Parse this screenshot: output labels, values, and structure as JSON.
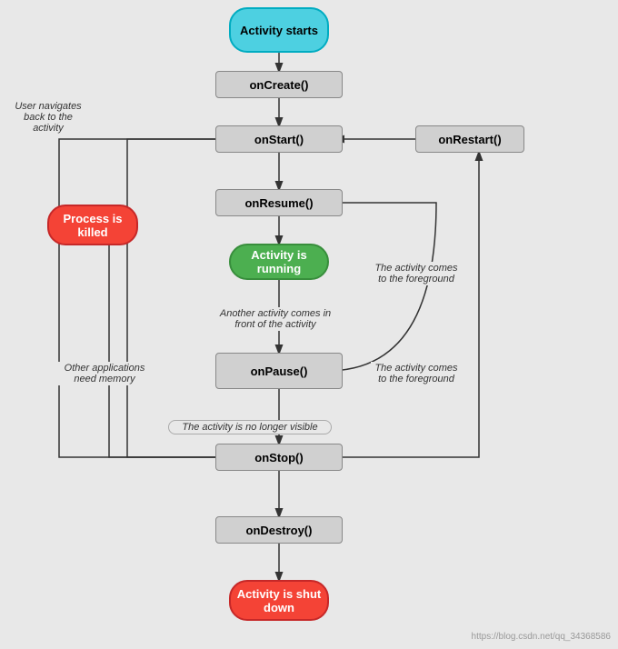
{
  "nodes": {
    "activity_starts": {
      "label": "Activity\nstarts",
      "type": "cyan"
    },
    "on_create": {
      "label": "onCreate()",
      "type": "rect"
    },
    "on_start": {
      "label": "onStart()",
      "type": "rect"
    },
    "on_restart": {
      "label": "onRestart()",
      "type": "rect"
    },
    "on_resume": {
      "label": "onResume()",
      "type": "rect"
    },
    "activity_running": {
      "label": "Activity is\nrunning",
      "type": "green"
    },
    "on_pause": {
      "label": "onPause()",
      "type": "rect"
    },
    "on_stop": {
      "label": "onStop()",
      "type": "rect"
    },
    "on_destroy": {
      "label": "onDestroy()",
      "type": "rect"
    },
    "activity_shutdown": {
      "label": "Activity is\nshut down",
      "type": "red"
    },
    "process_killed": {
      "label": "Process is\nkilled",
      "type": "red"
    }
  },
  "labels": {
    "user_navigates": "User navigates\nback to the\nactivity",
    "another_activity": "Another activity comes\nin front of the activity",
    "other_apps_memory": "Other applications\nneed memory",
    "activity_foreground1": "The activity\ncomes to the\nforeground",
    "activity_foreground2": "The activity\ncomes to the\nforeground",
    "no_longer_visible": "The activity is no longer visible"
  },
  "watermark": "https://blog.csdn.net/qq_34368586"
}
